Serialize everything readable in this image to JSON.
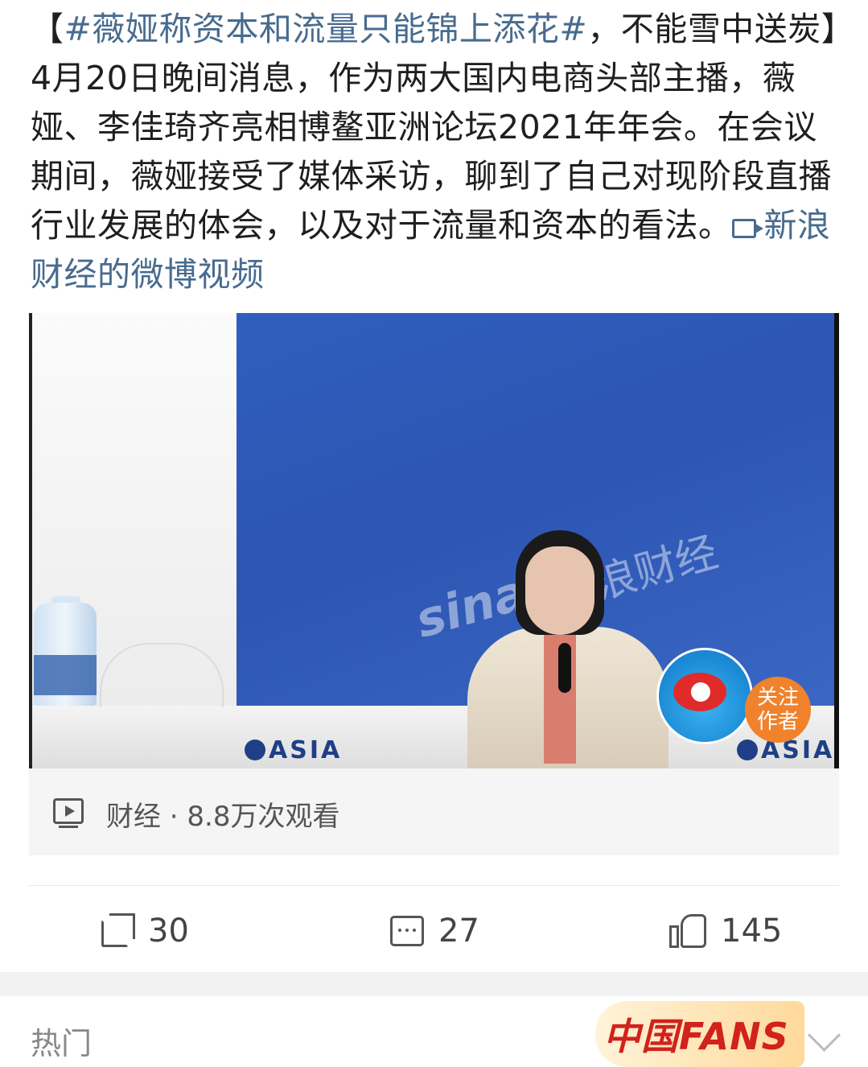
{
  "post": {
    "bracket_open": "【",
    "hashtag": "#薇娅称资本和流量只能锦上添花#",
    "text": "，不能雪中送炭】4月20日晚间消息，作为两大国内电商头部主播，薇娅、李佳琦齐亮相博鳌亚洲论坛2021年年会。在会议期间，薇娅接受了媒体采访，聊到了自己对现阶段直播行业发展的体会，以及对于流量和资本的看法。",
    "video_link": "新浪财经的微博视频"
  },
  "video": {
    "watermark_sina": "sina",
    "watermark_brand": "浪财经",
    "asia_text": "ASIA",
    "follow_badge": "关注\n作者"
  },
  "video_info": {
    "meta": "财经 · 8.8万次观看"
  },
  "actions": {
    "share_count": "30",
    "comment_count": "27",
    "like_count": "145"
  },
  "footer": {
    "hot_label": "热门",
    "fans_banner": "中国FANS"
  },
  "colors": {
    "link": "#486b8f",
    "wall_blue": "#2f5fbf",
    "badge_orange": "#f0822c"
  }
}
